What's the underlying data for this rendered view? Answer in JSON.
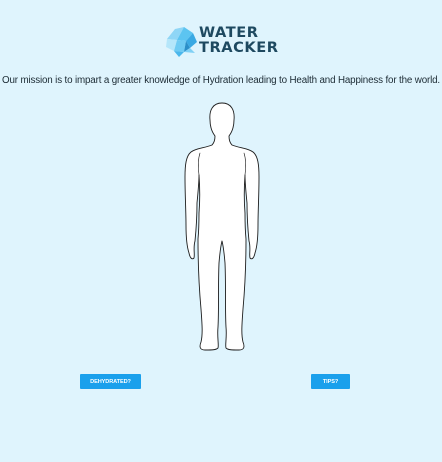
{
  "logo": {
    "line1": "WATER",
    "line2": "TRACKER",
    "mark_icon": "water-drop-logo-icon"
  },
  "mission_text": "Our mission is to impart a greater knowledge of Hydration leading to Health and Happiness for the world.",
  "figure": {
    "icon": "human-body-outline-icon"
  },
  "buttons": {
    "dehydrated_label": "DEHYDRATED?",
    "tips_label": "TIPS?"
  },
  "colors": {
    "background": "#dff4fd",
    "button": "#1aa0ec",
    "logo_text": "#1e4960",
    "logo_drop_light": "#9edcf7",
    "logo_drop_mid": "#55c0f0",
    "logo_drop_dark": "#2a8fc9"
  }
}
